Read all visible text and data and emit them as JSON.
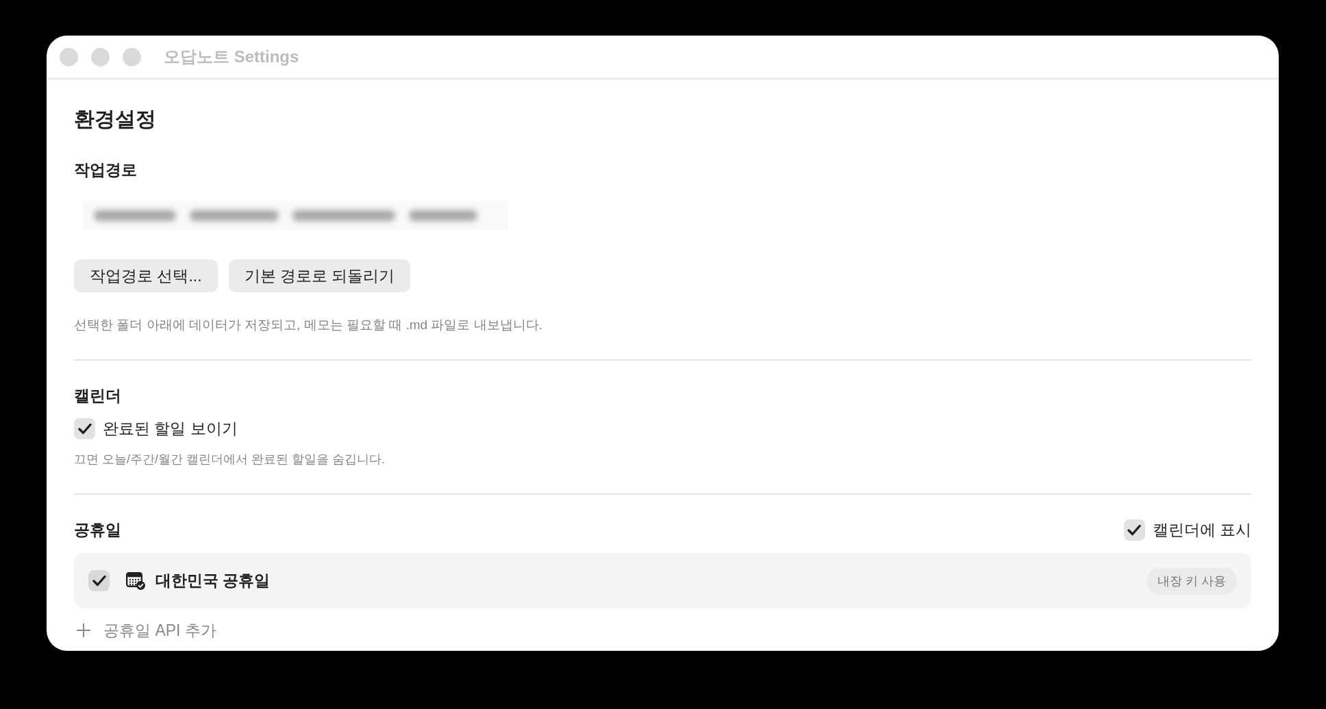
{
  "window": {
    "title": "오답노트 Settings"
  },
  "page_title": "환경설정",
  "workspace": {
    "heading": "작업경로",
    "buttons": [
      "작업경로 선택...",
      "기본 경로로 되돌리기"
    ],
    "description": "선택한 폴더 아래에 데이터가 저장되고, 메모는 필요할 때 .md 파일로 내보냅니다."
  },
  "calendar": {
    "heading": "캘린더",
    "show_completed": {
      "label": "완료된 할일 보이기",
      "checked": true
    },
    "hint": "끄면 오늘/주간/월간 캘린더에서 완료된 할일을 숨깁니다."
  },
  "holidays": {
    "heading": "공휴일",
    "show_on_calendar": {
      "label": "캘린더에 표시",
      "checked": true
    },
    "sources": [
      {
        "name": "대한민국 공휴일",
        "checked": true,
        "badge": "내장 키 사용"
      }
    ],
    "add_button": {
      "label": "공휴일 API 추가"
    }
  }
}
